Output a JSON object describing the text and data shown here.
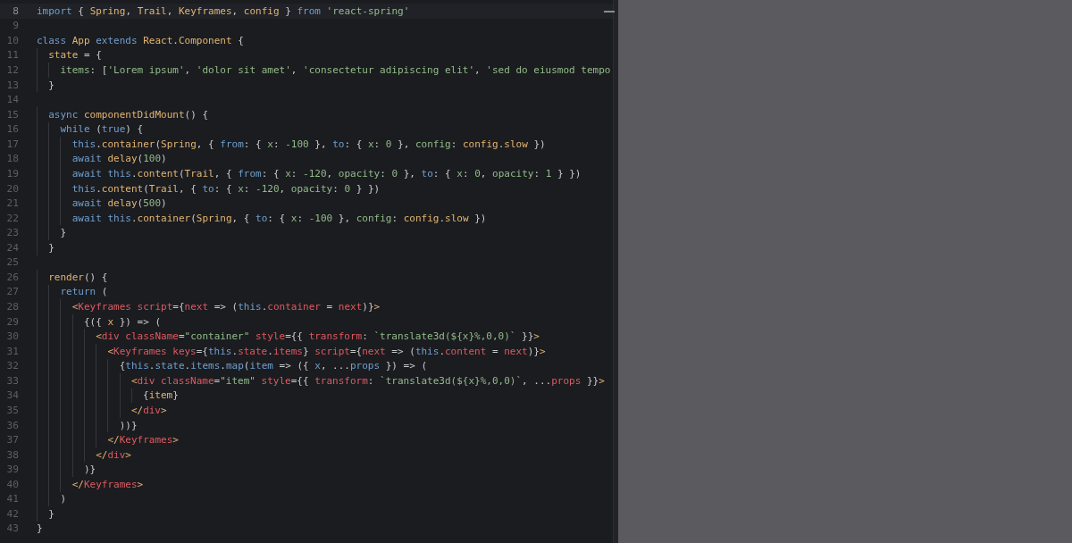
{
  "editor": {
    "lines": [
      {
        "number": "8",
        "current": true,
        "tokens": [
          {
            "kind": "keyword",
            "text": "import"
          },
          {
            "kind": "plain",
            "text": " { "
          },
          {
            "kind": "name",
            "text": "Spring"
          },
          {
            "kind": "plain",
            "text": ", "
          },
          {
            "kind": "name",
            "text": "Trail"
          },
          {
            "kind": "plain",
            "text": ", "
          },
          {
            "kind": "name",
            "text": "Keyframes"
          },
          {
            "kind": "plain",
            "text": ", "
          },
          {
            "kind": "name",
            "text": "config"
          },
          {
            "kind": "plain",
            "text": " } "
          },
          {
            "kind": "keyword",
            "text": "from "
          },
          {
            "kind": "string",
            "text": "'react-spring'"
          }
        ]
      },
      {
        "number": "9",
        "current": false
      },
      {
        "number": "10",
        "current": false,
        "tokens": [
          {
            "kind": "keyword",
            "text": "class "
          },
          {
            "kind": "name",
            "text": "App "
          },
          {
            "kind": "keyword",
            "text": "extends "
          },
          {
            "kind": "name",
            "text": "React"
          },
          {
            "kind": "plain",
            "text": "."
          },
          {
            "kind": "name",
            "text": "Component"
          },
          {
            "kind": "plain",
            "text": " {"
          }
        ]
      },
      {
        "number": "11",
        "current": false,
        "tokens": [
          {
            "kind": "name",
            "text": "  state"
          },
          {
            "kind": "plain",
            "text": " = {"
          }
        ]
      },
      {
        "number": "12",
        "current": false,
        "tokens": [
          {
            "kind": "attr",
            "text": "    items"
          },
          {
            "kind": "plain",
            "text": ": ["
          },
          {
            "kind": "string",
            "text": "'Lorem ipsum'"
          },
          {
            "kind": "plain",
            "text": ", "
          },
          {
            "kind": "string",
            "text": "'dolor sit amet'"
          },
          {
            "kind": "plain",
            "text": ", "
          },
          {
            "kind": "string",
            "text": "'consectetur adipiscing elit'"
          },
          {
            "kind": "plain",
            "text": ", "
          },
          {
            "kind": "string",
            "text": "'sed do eiusmod tempo"
          }
        ]
      },
      {
        "number": "13",
        "current": false,
        "tokens": [
          {
            "kind": "plain",
            "text": "  }"
          }
        ]
      },
      {
        "number": "14",
        "current": false
      },
      {
        "number": "15",
        "current": false,
        "tokens": [
          {
            "kind": "keyword",
            "text": "  async "
          },
          {
            "kind": "name",
            "text": "componentDidMount"
          },
          {
            "kind": "plain",
            "text": "() {"
          }
        ]
      },
      {
        "number": "16",
        "current": false,
        "tokens": [
          {
            "kind": "keyword",
            "text": "    while"
          },
          {
            "kind": "plain",
            "text": " ("
          },
          {
            "kind": "keyword",
            "text": "true"
          },
          {
            "kind": "plain",
            "text": ") {"
          }
        ]
      },
      {
        "number": "17",
        "current": false,
        "tokens": [
          {
            "kind": "keyword",
            "text": "      this"
          },
          {
            "kind": "plain",
            "text": "."
          },
          {
            "kind": "name",
            "text": "container"
          },
          {
            "kind": "plain",
            "text": "("
          },
          {
            "kind": "name",
            "text": "Spring"
          },
          {
            "kind": "plain",
            "text": ", { "
          },
          {
            "kind": "keyword",
            "text": "from"
          },
          {
            "kind": "plain",
            "text": ": { "
          },
          {
            "kind": "attr",
            "text": "x"
          },
          {
            "kind": "plain",
            "text": ": "
          },
          {
            "kind": "attr",
            "text": "-100"
          },
          {
            "kind": "plain",
            "text": " }, "
          },
          {
            "kind": "keyword",
            "text": "to"
          },
          {
            "kind": "plain",
            "text": ": { "
          },
          {
            "kind": "attr",
            "text": "x"
          },
          {
            "kind": "plain",
            "text": ": "
          },
          {
            "kind": "attr",
            "text": "0"
          },
          {
            "kind": "plain",
            "text": " }, "
          },
          {
            "kind": "attr",
            "text": "config"
          },
          {
            "kind": "plain",
            "text": ": "
          },
          {
            "kind": "name",
            "text": "config"
          },
          {
            "kind": "plain",
            "text": "."
          },
          {
            "kind": "name",
            "text": "slow"
          },
          {
            "kind": "plain",
            "text": " })"
          }
        ]
      },
      {
        "number": "18",
        "current": false,
        "tokens": [
          {
            "kind": "keyword",
            "text": "      await "
          },
          {
            "kind": "name",
            "text": "delay"
          },
          {
            "kind": "plain",
            "text": "("
          },
          {
            "kind": "attr",
            "text": "100"
          },
          {
            "kind": "plain",
            "text": ")"
          }
        ]
      },
      {
        "number": "19",
        "current": false,
        "tokens": [
          {
            "kind": "keyword",
            "text": "      await this"
          },
          {
            "kind": "plain",
            "text": "."
          },
          {
            "kind": "name",
            "text": "content"
          },
          {
            "kind": "plain",
            "text": "("
          },
          {
            "kind": "name",
            "text": "Trail"
          },
          {
            "kind": "plain",
            "text": ", { "
          },
          {
            "kind": "keyword",
            "text": "from"
          },
          {
            "kind": "plain",
            "text": ": { "
          },
          {
            "kind": "attr",
            "text": "x"
          },
          {
            "kind": "plain",
            "text": ": "
          },
          {
            "kind": "attr",
            "text": "-120"
          },
          {
            "kind": "plain",
            "text": ", "
          },
          {
            "kind": "attr",
            "text": "opacity"
          },
          {
            "kind": "plain",
            "text": ": "
          },
          {
            "kind": "attr",
            "text": "0"
          },
          {
            "kind": "plain",
            "text": " }, "
          },
          {
            "kind": "keyword",
            "text": "to"
          },
          {
            "kind": "plain",
            "text": ": { "
          },
          {
            "kind": "attr",
            "text": "x"
          },
          {
            "kind": "plain",
            "text": ": "
          },
          {
            "kind": "attr",
            "text": "0"
          },
          {
            "kind": "plain",
            "text": ", "
          },
          {
            "kind": "attr",
            "text": "opacity"
          },
          {
            "kind": "plain",
            "text": ": "
          },
          {
            "kind": "attr",
            "text": "1"
          },
          {
            "kind": "plain",
            "text": " } })"
          }
        ]
      },
      {
        "number": "20",
        "current": false,
        "tokens": [
          {
            "kind": "keyword",
            "text": "      this"
          },
          {
            "kind": "plain",
            "text": "."
          },
          {
            "kind": "name",
            "text": "content"
          },
          {
            "kind": "plain",
            "text": "("
          },
          {
            "kind": "name",
            "text": "Trail"
          },
          {
            "kind": "plain",
            "text": ", { "
          },
          {
            "kind": "keyword",
            "text": "to"
          },
          {
            "kind": "plain",
            "text": ": { "
          },
          {
            "kind": "attr",
            "text": "x"
          },
          {
            "kind": "plain",
            "text": ": "
          },
          {
            "kind": "attr",
            "text": "-120"
          },
          {
            "kind": "plain",
            "text": ", "
          },
          {
            "kind": "attr",
            "text": "opacity"
          },
          {
            "kind": "plain",
            "text": ": "
          },
          {
            "kind": "attr",
            "text": "0"
          },
          {
            "kind": "plain",
            "text": " } })"
          }
        ]
      },
      {
        "number": "21",
        "current": false,
        "tokens": [
          {
            "kind": "keyword",
            "text": "      await "
          },
          {
            "kind": "name",
            "text": "delay"
          },
          {
            "kind": "plain",
            "text": "("
          },
          {
            "kind": "attr",
            "text": "500"
          },
          {
            "kind": "plain",
            "text": ")"
          }
        ]
      },
      {
        "number": "22",
        "current": false,
        "tokens": [
          {
            "kind": "keyword",
            "text": "      await this"
          },
          {
            "kind": "plain",
            "text": "."
          },
          {
            "kind": "name",
            "text": "container"
          },
          {
            "kind": "plain",
            "text": "("
          },
          {
            "kind": "name",
            "text": "Spring"
          },
          {
            "kind": "plain",
            "text": ", { "
          },
          {
            "kind": "keyword",
            "text": "to"
          },
          {
            "kind": "plain",
            "text": ": { "
          },
          {
            "kind": "attr",
            "text": "x"
          },
          {
            "kind": "plain",
            "text": ": "
          },
          {
            "kind": "attr",
            "text": "-100"
          },
          {
            "kind": "plain",
            "text": " }, "
          },
          {
            "kind": "attr",
            "text": "config"
          },
          {
            "kind": "plain",
            "text": ": "
          },
          {
            "kind": "name",
            "text": "config"
          },
          {
            "kind": "plain",
            "text": "."
          },
          {
            "kind": "name",
            "text": "slow"
          },
          {
            "kind": "plain",
            "text": " })"
          }
        ]
      },
      {
        "number": "23",
        "current": false,
        "tokens": [
          {
            "kind": "plain",
            "text": "    }"
          }
        ]
      },
      {
        "number": "24",
        "current": false,
        "tokens": [
          {
            "kind": "plain",
            "text": "  }"
          }
        ]
      },
      {
        "number": "25",
        "current": false
      },
      {
        "number": "26",
        "current": false,
        "tokens": [
          {
            "kind": "name",
            "text": "  render"
          },
          {
            "kind": "plain",
            "text": "() {"
          }
        ]
      },
      {
        "number": "27",
        "current": false,
        "tokens": [
          {
            "kind": "keyword",
            "text": "    return"
          },
          {
            "kind": "plain",
            "text": " ("
          }
        ]
      },
      {
        "number": "28",
        "current": false,
        "tokens": [
          {
            "kind": "bracket",
            "text": "      <"
          },
          {
            "kind": "tag",
            "text": "Keyframes script"
          },
          {
            "kind": "plain",
            "text": "={"
          },
          {
            "kind": "tag",
            "text": "next"
          },
          {
            "kind": "plain",
            "text": " => ("
          },
          {
            "kind": "keyword",
            "text": "this"
          },
          {
            "kind": "plain",
            "text": "."
          },
          {
            "kind": "tag",
            "text": "container"
          },
          {
            "kind": "plain",
            "text": " = "
          },
          {
            "kind": "tag",
            "text": "next"
          },
          {
            "kind": "plain",
            "text": ")}"
          },
          {
            "kind": "bracket",
            "text": ">"
          }
        ]
      },
      {
        "number": "29",
        "current": false,
        "tokens": [
          {
            "kind": "plain",
            "text": "        {({ "
          },
          {
            "kind": "name",
            "text": "x"
          },
          {
            "kind": "plain",
            "text": " }) => ("
          }
        ]
      },
      {
        "number": "30",
        "current": false,
        "tokens": [
          {
            "kind": "bracket",
            "text": "          <"
          },
          {
            "kind": "tag",
            "text": "div className"
          },
          {
            "kind": "plain",
            "text": "="
          },
          {
            "kind": "string",
            "text": "\"container\""
          },
          {
            "kind": "tag",
            "text": " style"
          },
          {
            "kind": "plain",
            "text": "={{ "
          },
          {
            "kind": "tag",
            "text": "transform"
          },
          {
            "kind": "plain",
            "text": ": "
          },
          {
            "kind": "string",
            "text": "`translate3d(${x}%,0,0)`"
          },
          {
            "kind": "plain",
            "text": " }}"
          },
          {
            "kind": "bracket",
            "text": ">"
          }
        ]
      },
      {
        "number": "31",
        "current": false,
        "tokens": [
          {
            "kind": "bracket",
            "text": "            <"
          },
          {
            "kind": "tag",
            "text": "Keyframes keys"
          },
          {
            "kind": "plain",
            "text": "={"
          },
          {
            "kind": "keyword",
            "text": "this"
          },
          {
            "kind": "plain",
            "text": "."
          },
          {
            "kind": "tag",
            "text": "state"
          },
          {
            "kind": "plain",
            "text": "."
          },
          {
            "kind": "tag",
            "text": "items"
          },
          {
            "kind": "plain",
            "text": "} "
          },
          {
            "kind": "tag",
            "text": "script"
          },
          {
            "kind": "plain",
            "text": "={"
          },
          {
            "kind": "tag",
            "text": "next"
          },
          {
            "kind": "plain",
            "text": " => ("
          },
          {
            "kind": "keyword",
            "text": "this"
          },
          {
            "kind": "plain",
            "text": "."
          },
          {
            "kind": "tag",
            "text": "content"
          },
          {
            "kind": "plain",
            "text": " = "
          },
          {
            "kind": "tag",
            "text": "next"
          },
          {
            "kind": "plain",
            "text": ")}"
          },
          {
            "kind": "bracket",
            "text": ">"
          }
        ]
      },
      {
        "number": "32",
        "current": false,
        "tokens": [
          {
            "kind": "plain",
            "text": "              {"
          },
          {
            "kind": "keyword",
            "text": "this"
          },
          {
            "kind": "plain",
            "text": "."
          },
          {
            "kind": "keyword",
            "text": "state"
          },
          {
            "kind": "plain",
            "text": "."
          },
          {
            "kind": "keyword",
            "text": "items"
          },
          {
            "kind": "plain",
            "text": "."
          },
          {
            "kind": "keyword",
            "text": "map"
          },
          {
            "kind": "plain",
            "text": "("
          },
          {
            "kind": "keyword",
            "text": "item"
          },
          {
            "kind": "plain",
            "text": " => ({ "
          },
          {
            "kind": "keyword",
            "text": "x"
          },
          {
            "kind": "plain",
            "text": ", ..."
          },
          {
            "kind": "keyword",
            "text": "props"
          },
          {
            "kind": "plain",
            "text": " }) => ("
          }
        ]
      },
      {
        "number": "33",
        "current": false,
        "tokens": [
          {
            "kind": "bracket",
            "text": "                <"
          },
          {
            "kind": "tag",
            "text": "div className"
          },
          {
            "kind": "plain",
            "text": "="
          },
          {
            "kind": "string",
            "text": "\"item\""
          },
          {
            "kind": "tag",
            "text": " style"
          },
          {
            "kind": "plain",
            "text": "={{ "
          },
          {
            "kind": "tag",
            "text": "transform"
          },
          {
            "kind": "plain",
            "text": ": "
          },
          {
            "kind": "string",
            "text": "`translate3d(${x}%,0,0)`"
          },
          {
            "kind": "plain",
            "text": ", ..."
          },
          {
            "kind": "tag",
            "text": "props"
          },
          {
            "kind": "plain",
            "text": " }}"
          },
          {
            "kind": "bracket",
            "text": ">"
          }
        ]
      },
      {
        "number": "34",
        "current": false,
        "tokens": [
          {
            "kind": "plain",
            "text": "                  {"
          },
          {
            "kind": "name",
            "text": "item"
          },
          {
            "kind": "plain",
            "text": "}"
          }
        ]
      },
      {
        "number": "35",
        "current": false,
        "tokens": [
          {
            "kind": "bracket",
            "text": "                </"
          },
          {
            "kind": "tag",
            "text": "div"
          },
          {
            "kind": "bracket",
            "text": ">"
          }
        ]
      },
      {
        "number": "36",
        "current": false,
        "tokens": [
          {
            "kind": "plain",
            "text": "              ))}"
          }
        ]
      },
      {
        "number": "37",
        "current": false,
        "tokens": [
          {
            "kind": "bracket",
            "text": "            </"
          },
          {
            "kind": "tag",
            "text": "Keyframes"
          },
          {
            "kind": "bracket",
            "text": ">"
          }
        ]
      },
      {
        "number": "38",
        "current": false,
        "tokens": [
          {
            "kind": "bracket",
            "text": "          </"
          },
          {
            "kind": "tag",
            "text": "div"
          },
          {
            "kind": "bracket",
            "text": ">"
          }
        ]
      },
      {
        "number": "39",
        "current": false,
        "tokens": [
          {
            "kind": "plain",
            "text": "        )}"
          }
        ]
      },
      {
        "number": "40",
        "current": false,
        "tokens": [
          {
            "kind": "bracket",
            "text": "      </"
          },
          {
            "kind": "tag",
            "text": "Keyframes"
          },
          {
            "kind": "bracket",
            "text": ">"
          }
        ]
      },
      {
        "number": "41",
        "current": false,
        "tokens": [
          {
            "kind": "plain",
            "text": "    )"
          }
        ]
      },
      {
        "number": "42",
        "current": false,
        "tokens": [
          {
            "kind": "plain",
            "text": "  }"
          }
        ]
      },
      {
        "number": "43",
        "current": false,
        "tokens": [
          {
            "kind": "plain",
            "text": "}"
          }
        ]
      }
    ]
  }
}
